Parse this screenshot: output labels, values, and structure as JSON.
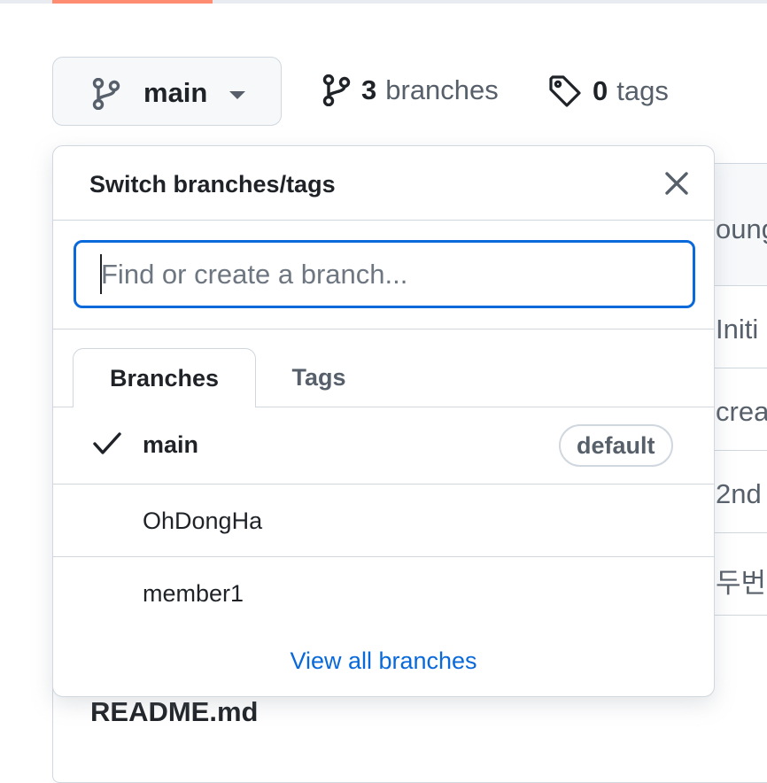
{
  "header": {
    "current_branch": "main",
    "branches_count": "3",
    "branches_label": "branches",
    "tags_count": "0",
    "tags_label": "tags"
  },
  "background": {
    "rows": [
      "oung",
      "Initi",
      "crea",
      "2nd",
      "두번"
    ],
    "readme_title": "README.md"
  },
  "dropdown": {
    "title": "Switch branches/tags",
    "search_placeholder": "Find or create a branch...",
    "tabs": [
      {
        "label": "Branches",
        "active": true
      },
      {
        "label": "Tags",
        "active": false
      }
    ],
    "branches": [
      {
        "name": "main",
        "selected": true,
        "badge": "default"
      },
      {
        "name": "OhDongHa",
        "selected": false
      },
      {
        "name": "member1",
        "selected": false
      }
    ],
    "view_all_label": "View all branches"
  },
  "colors": {
    "accent_tab_underline": "#fd8c73",
    "focus_border": "#0969da",
    "link": "#0969da"
  },
  "icons": {
    "branch": "git-branch-icon",
    "tag": "tag-icon",
    "close": "close-icon",
    "check": "check-icon",
    "caret": "triangle-down-icon"
  }
}
